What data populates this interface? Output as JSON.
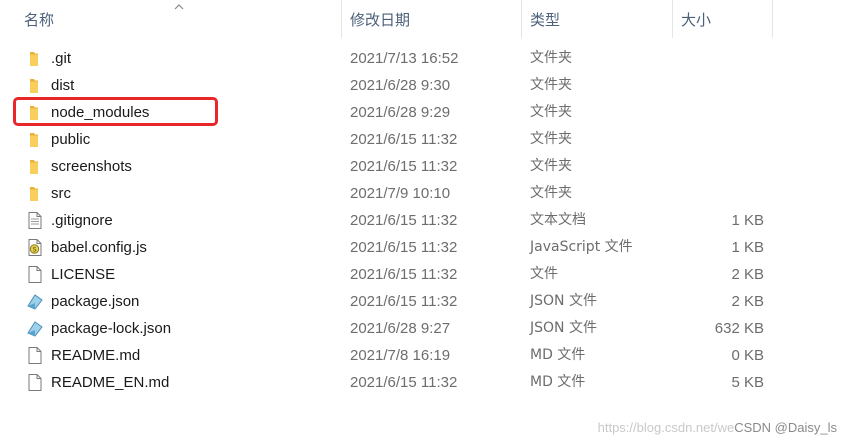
{
  "columns": {
    "name": "名称",
    "date": "修改日期",
    "type": "类型",
    "size": "大小"
  },
  "files": [
    {
      "name": ".git",
      "date": "2021/7/13 16:52",
      "type": "文件夹",
      "size": "",
      "icon": "folder-icon"
    },
    {
      "name": "dist",
      "date": "2021/6/28 9:30",
      "type": "文件夹",
      "size": "",
      "icon": "folder-icon"
    },
    {
      "name": "node_modules",
      "date": "2021/6/28 9:29",
      "type": "文件夹",
      "size": "",
      "icon": "folder-icon"
    },
    {
      "name": "public",
      "date": "2021/6/15 11:32",
      "type": "文件夹",
      "size": "",
      "icon": "folder-icon"
    },
    {
      "name": "screenshots",
      "date": "2021/6/15 11:32",
      "type": "文件夹",
      "size": "",
      "icon": "folder-icon"
    },
    {
      "name": "src",
      "date": "2021/7/9 10:10",
      "type": "文件夹",
      "size": "",
      "icon": "folder-icon"
    },
    {
      "name": ".gitignore",
      "date": "2021/6/15 11:32",
      "type": "文本文档",
      "size": "1 KB",
      "icon": "text-file-icon"
    },
    {
      "name": "babel.config.js",
      "date": "2021/6/15 11:32",
      "type": "JavaScript 文件",
      "size": "1 KB",
      "icon": "javascript-file-icon"
    },
    {
      "name": "LICENSE",
      "date": "2021/6/15 11:32",
      "type": "文件",
      "size": "2 KB",
      "icon": "blank-file-icon"
    },
    {
      "name": "package.json",
      "date": "2021/6/15 11:32",
      "type": "JSON 文件",
      "size": "2 KB",
      "icon": "json-file-icon"
    },
    {
      "name": "package-lock.json",
      "date": "2021/6/28 9:27",
      "type": "JSON 文件",
      "size": "632 KB",
      "icon": "json-file-icon"
    },
    {
      "name": "README.md",
      "date": "2021/7/8 16:19",
      "type": "MD 文件",
      "size": "0 KB",
      "icon": "blank-file-icon"
    },
    {
      "name": "README_EN.md",
      "date": "2021/6/15 11:32",
      "type": "MD 文件",
      "size": "5 KB",
      "icon": "blank-file-icon"
    }
  ],
  "watermark": {
    "faint": "https://blog.csdn.net/we",
    "strong": "CSDN @Daisy_ls"
  },
  "colors": {
    "highlight": "#e8272b",
    "folder": "#f4c542",
    "header_text": "#4c607a"
  }
}
